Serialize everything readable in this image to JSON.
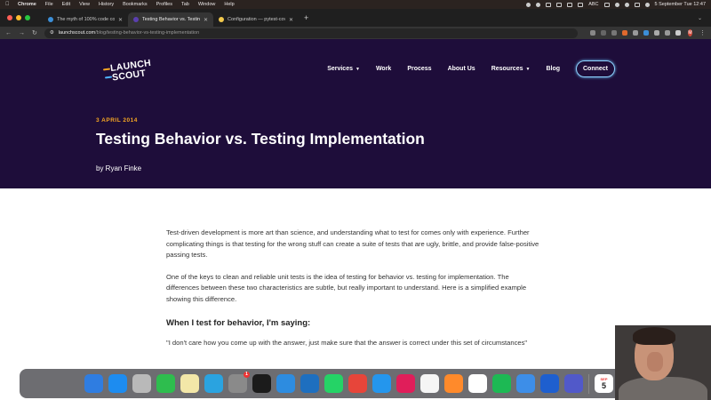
{
  "menubar": {
    "app": "Chrome",
    "items": [
      "File",
      "Edit",
      "View",
      "History",
      "Bookmarks",
      "Profiles",
      "Tab",
      "Window",
      "Help"
    ],
    "input_indicator": "ABC",
    "datetime": "5 September Tue 12:47"
  },
  "tabs": [
    {
      "title": "The myth of 100% code cover",
      "favicon_color": "#3c8fd8",
      "active": false
    },
    {
      "title": "Testing Behavior vs. Testing Im",
      "favicon_color": "#2a1a55",
      "active": true
    },
    {
      "title": "Configuration — pytest-cov 4.",
      "favicon_color": "#f2c94c",
      "active": false
    }
  ],
  "address_bar": {
    "host": "launchscout.com",
    "path": "/blog/testing-behavior-vs-testing-implementation"
  },
  "profile_initial": "M",
  "site": {
    "logo_line1": "LAUNCH",
    "logo_line2": "SCOUT",
    "nav": {
      "services": "Services",
      "work": "Work",
      "process": "Process",
      "about": "About Us",
      "resources": "Resources",
      "blog": "Blog",
      "connect": "Connect"
    },
    "post_date": "3 APRIL 2014",
    "post_title": "Testing Behavior vs. Testing Implementation",
    "byline": "by Ryan Finke"
  },
  "article": {
    "p1": "Test-driven development is more art than science, and understanding what to test for comes only with experience. Further complicating things is that testing for the wrong stuff can create a suite of tests that are ugly, brittle, and provide false-positive passing tests.",
    "p2": "One of the keys to clean and reliable unit tests is the idea of testing for behavior vs. testing for implementation. The differences between these two characteristics are subtle, but really important to understand. Here is a simplified example showing this difference.",
    "h1": "When I test for behavior, I'm saying:",
    "p3": "\"I don't care how you come up with the answer, just make sure that the answer is correct under this set of circumstances\""
  },
  "dock": {
    "calendar_month": "SEP",
    "calendar_day": "5",
    "badge_count": "1"
  },
  "colors": {
    "hero_bg": "#1e0d3a",
    "accent_orange": "#f5a623",
    "connect_border": "#8fd3ff"
  }
}
